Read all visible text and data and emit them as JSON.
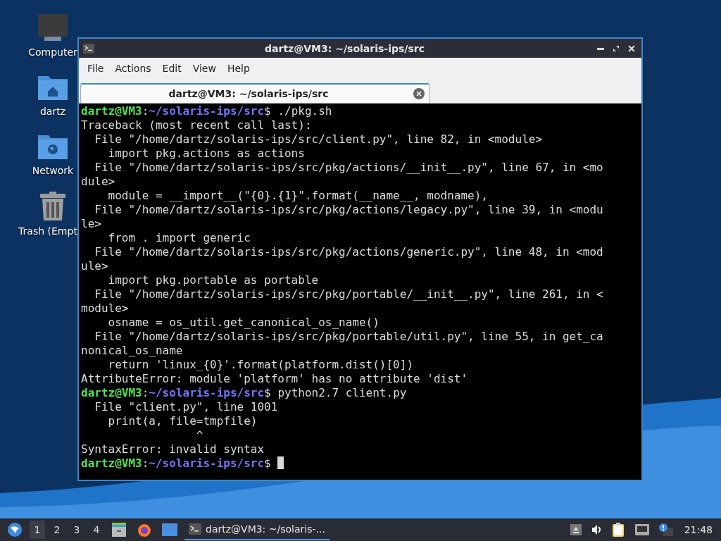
{
  "desktop": {
    "icons": [
      {
        "kind": "computer",
        "label": "Computer"
      },
      {
        "kind": "home",
        "label": "dartz"
      },
      {
        "kind": "network",
        "label": "Network"
      },
      {
        "kind": "trash",
        "label": "Trash (Empt"
      }
    ]
  },
  "window": {
    "title": "dartz@VM3: ~/solaris-ips/src",
    "menu": [
      "File",
      "Actions",
      "Edit",
      "View",
      "Help"
    ],
    "tabs": [
      {
        "label": "dartz@VM3: ~/solaris-ips/src",
        "selected": true
      }
    ],
    "terminal": {
      "lines": [
        {
          "kind": "prompt",
          "user": "dartz@VM3",
          "colon": ":",
          "path": "~/solaris-ips/src",
          "command": "$ ./pkg.sh",
          "cursor": false
        },
        {
          "kind": "output",
          "text": "Traceback (most recent call last):"
        },
        {
          "kind": "output",
          "text": "  File \"/home/dartz/solaris-ips/src/client.py\", line 82, in <module>"
        },
        {
          "kind": "output",
          "text": "    import pkg.actions as actions"
        },
        {
          "kind": "output",
          "text": "  File \"/home/dartz/solaris-ips/src/pkg/actions/__init__.py\", line 67, in <mo"
        },
        {
          "kind": "output",
          "text": "dule>"
        },
        {
          "kind": "output",
          "text": "    module = __import__(\"{0}.{1}\".format(__name__, modname),"
        },
        {
          "kind": "output",
          "text": "  File \"/home/dartz/solaris-ips/src/pkg/actions/legacy.py\", line 39, in <modu"
        },
        {
          "kind": "output",
          "text": "le>"
        },
        {
          "kind": "output",
          "text": "    from . import generic"
        },
        {
          "kind": "output",
          "text": "  File \"/home/dartz/solaris-ips/src/pkg/actions/generic.py\", line 48, in <mod"
        },
        {
          "kind": "output",
          "text": "ule>"
        },
        {
          "kind": "output",
          "text": "    import pkg.portable as portable"
        },
        {
          "kind": "output",
          "text": "  File \"/home/dartz/solaris-ips/src/pkg/portable/__init__.py\", line 261, in <"
        },
        {
          "kind": "output",
          "text": "module>"
        },
        {
          "kind": "output",
          "text": "    osname = os_util.get_canonical_os_name()"
        },
        {
          "kind": "output",
          "text": "  File \"/home/dartz/solaris-ips/src/pkg/portable/util.py\", line 55, in get_ca"
        },
        {
          "kind": "output",
          "text": "nonical_os_name"
        },
        {
          "kind": "output",
          "text": "    return 'linux_{0}'.format(platform.dist()[0])"
        },
        {
          "kind": "output",
          "text": "AttributeError: module 'platform' has no attribute 'dist'"
        },
        {
          "kind": "prompt",
          "user": "dartz@VM3",
          "colon": ":",
          "path": "~/solaris-ips/src",
          "command": "$ python2.7 client.py",
          "cursor": false
        },
        {
          "kind": "output",
          "text": "  File \"client.py\", line 1001"
        },
        {
          "kind": "output",
          "text": "    print(a, file=tmpfile)"
        },
        {
          "kind": "output",
          "text": "                 ^"
        },
        {
          "kind": "output",
          "text": "SyntaxError: invalid syntax"
        },
        {
          "kind": "prompt",
          "user": "dartz@VM3",
          "colon": ":",
          "path": "~/solaris-ips/src",
          "command": "$",
          "cursor": true
        }
      ]
    }
  },
  "taskbar": {
    "workspaces": [
      {
        "label": "1",
        "selected": true
      },
      {
        "label": "2",
        "selected": false
      },
      {
        "label": "3",
        "selected": false
      },
      {
        "label": "4",
        "selected": false
      }
    ],
    "tasks": [
      {
        "label": "dartz@VM3: ~/solaris-...",
        "selected": true
      }
    ],
    "clock": "21:48"
  }
}
